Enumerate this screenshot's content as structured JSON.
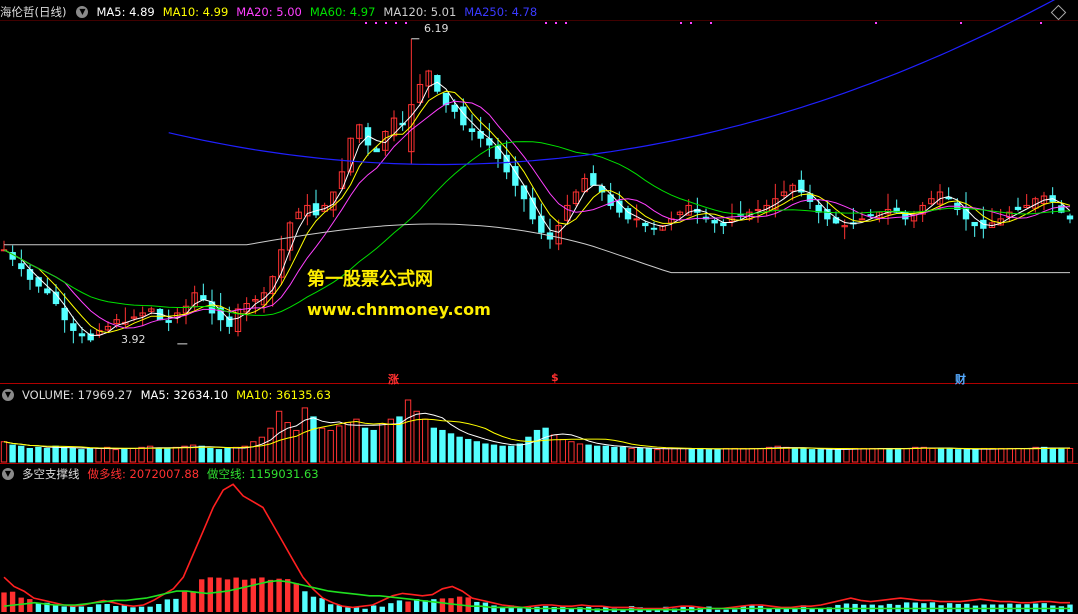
{
  "main_header": {
    "title": "海伦哲(日线)",
    "ma5": "MA5: 4.89",
    "ma10": "MA10: 4.99",
    "ma20": "MA20: 5.00",
    "ma60": "MA60: 4.97",
    "ma120": "MA120: 5.01",
    "ma250": "MA250: 4.78"
  },
  "price_labels": {
    "high": "6.19",
    "low": "3.92"
  },
  "event_tags": {
    "zhang": "涨",
    "dollar": "$",
    "cai": "财"
  },
  "watermark": {
    "line1": "第一股票公式网",
    "line2": "www.chnmoney.com"
  },
  "volume_header": {
    "volume": "VOLUME: 17969.27",
    "ma5": "MA5: 32634.10",
    "ma10": "MA10: 36135.63"
  },
  "indicator_header": {
    "title": "多空支撑线",
    "long_line": "做多线: 2072007.88",
    "short_line": "做空线: 1159031.63"
  },
  "colors": {
    "up": "#ff3232",
    "down": "#54ffff",
    "ma5": "#ffffff",
    "ma10": "#ffff00",
    "ma20": "#ff40ff",
    "ma60": "#00e000",
    "ma120": "#cccccc",
    "ma250": "#2020ff",
    "grid": "#b00000",
    "text": "#dddddd"
  },
  "chart_data": [
    {
      "type": "candlestick",
      "title": "海伦哲(日线)",
      "y_range": [
        3.8,
        6.3
      ],
      "annotated_high": 6.19,
      "annotated_low": 3.92,
      "close_path": [
        4.62,
        4.55,
        4.48,
        4.4,
        4.35,
        4.3,
        4.22,
        4.1,
        4.02,
        3.98,
        3.95,
        4.02,
        4.05,
        4.1,
        4.08,
        4.12,
        4.15,
        4.18,
        4.1,
        4.08,
        4.15,
        4.2,
        4.3,
        4.25,
        4.15,
        4.1,
        4.05,
        4.18,
        4.22,
        4.25,
        4.3,
        4.42,
        4.62,
        4.82,
        4.9,
        4.95,
        4.88,
        4.95,
        5.05,
        5.2,
        5.45,
        5.55,
        5.4,
        5.35,
        5.5,
        5.6,
        5.55,
        5.7,
        5.85,
        5.95,
        5.8,
        5.7,
        5.65,
        5.55,
        5.5,
        5.45,
        5.4,
        5.3,
        5.2,
        5.1,
        5.0,
        4.85,
        4.75,
        4.7,
        4.8,
        4.95,
        5.05,
        5.15,
        5.1,
        5.05,
        4.95,
        4.9,
        4.85,
        4.85,
        4.8,
        4.78,
        4.8,
        4.85,
        4.9,
        4.95,
        4.9,
        4.85,
        4.82,
        4.8,
        4.85,
        4.88,
        4.9,
        4.92,
        4.95,
        5.0,
        5.05,
        5.1,
        5.05,
        4.98,
        4.9,
        4.85,
        4.82,
        4.8,
        4.82,
        4.85,
        4.88,
        4.9,
        4.92,
        4.9,
        4.85,
        4.88,
        4.95,
        5.0,
        5.05,
        5.0,
        4.92,
        4.85,
        4.8,
        4.78,
        4.82,
        4.85,
        4.9,
        4.92,
        4.95,
        5.0,
        5.02,
        4.98,
        4.9,
        4.85
      ],
      "series_names": [
        "MA5",
        "MA10",
        "MA20",
        "MA60",
        "MA120",
        "MA250"
      ],
      "latest": {
        "MA5": 4.89,
        "MA10": 4.99,
        "MA20": 5.0,
        "MA60": 4.97,
        "MA120": 5.01,
        "MA250": 4.78
      }
    },
    {
      "type": "bar",
      "title": "VOLUME",
      "values": [
        18,
        15,
        14,
        12,
        13,
        12,
        14,
        13,
        12,
        11,
        12,
        12,
        13,
        11,
        12,
        12,
        13,
        14,
        12,
        12,
        13,
        14,
        15,
        14,
        12,
        11,
        12,
        13,
        14,
        18,
        22,
        30,
        45,
        35,
        28,
        48,
        40,
        30,
        28,
        32,
        35,
        38,
        30,
        28,
        34,
        38,
        40,
        55,
        45,
        38,
        30,
        28,
        25,
        22,
        20,
        18,
        16,
        15,
        14,
        14,
        16,
        22,
        28,
        30,
        24,
        20,
        18,
        16,
        15,
        14,
        14,
        13,
        13,
        12,
        12,
        12,
        11,
        12,
        12,
        12,
        12,
        12,
        11,
        11,
        12,
        12,
        12,
        12,
        12,
        13,
        14,
        13,
        12,
        12,
        11,
        11,
        11,
        11,
        12,
        12,
        12,
        12,
        12,
        12,
        12,
        12,
        13,
        13,
        12,
        12,
        12,
        11,
        11,
        11,
        12,
        12,
        12,
        12,
        12,
        12,
        13,
        13,
        12,
        12,
        12
      ],
      "series": [
        {
          "name": "MA5",
          "latest": 32634.1
        },
        {
          "name": "MA10",
          "latest": 36135.63
        }
      ],
      "latest": 17969.27
    },
    {
      "type": "line",
      "title": "多空支撑线",
      "series": [
        {
          "name": "做多线",
          "latest": 2072007.88,
          "shape": [
            0.3,
            0.22,
            0.18,
            0.12,
            0.1,
            0.08,
            0.06,
            0.05,
            0.06,
            0.08,
            0.1,
            0.08,
            0.06,
            0.05,
            0.06,
            0.1,
            0.15,
            0.2,
            0.3,
            0.5,
            0.7,
            0.9,
            1.05,
            1.1,
            1.0,
            0.95,
            0.9,
            0.75,
            0.6,
            0.45,
            0.3,
            0.2,
            0.12,
            0.08,
            0.05,
            0.04,
            0.05,
            0.06,
            0.1,
            0.14,
            0.16,
            0.15,
            0.14,
            0.15,
            0.2,
            0.22,
            0.18,
            0.12,
            0.1,
            0.08,
            0.06,
            0.05,
            0.04,
            0.05,
            0.06,
            0.06,
            0.05,
            0.05,
            0.06,
            0.05,
            0.05,
            0.04,
            0.04,
            0.04,
            0.03,
            0.03,
            0.03,
            0.04,
            0.05,
            0.05,
            0.04,
            0.03,
            0.03,
            0.04,
            0.05,
            0.06,
            0.06,
            0.05,
            0.04,
            0.04,
            0.05,
            0.05,
            0.06,
            0.08,
            0.1,
            0.12,
            0.1,
            0.09,
            0.1,
            0.11,
            0.12,
            0.11,
            0.1,
            0.1,
            0.09,
            0.09,
            0.09,
            0.1,
            0.11,
            0.1,
            0.09,
            0.09,
            0.08,
            0.08,
            0.09,
            0.09,
            0.08,
            0.08
          ]
        },
        {
          "name": "做空线",
          "latest": 1159031.63,
          "shape": [
            0.05,
            0.06,
            0.07,
            0.08,
            0.07,
            0.06,
            0.06,
            0.06,
            0.07,
            0.08,
            0.09,
            0.1,
            0.1,
            0.11,
            0.12,
            0.14,
            0.16,
            0.18,
            0.18,
            0.17,
            0.16,
            0.17,
            0.18,
            0.2,
            0.22,
            0.24,
            0.26,
            0.27,
            0.26,
            0.24,
            0.22,
            0.2,
            0.18,
            0.17,
            0.16,
            0.15,
            0.14,
            0.14,
            0.13,
            0.12,
            0.11,
            0.1,
            0.09,
            0.08,
            0.07,
            0.06,
            0.05,
            0.05,
            0.04,
            0.04,
            0.04,
            0.04,
            0.03,
            0.03,
            0.03,
            0.03,
            0.03,
            0.03,
            0.02,
            0.02,
            0.02,
            0.02,
            0.02,
            0.02,
            0.02,
            0.02,
            0.02,
            0.02,
            0.02,
            0.03,
            0.03,
            0.03,
            0.03,
            0.03,
            0.03,
            0.03,
            0.03,
            0.03,
            0.03,
            0.03,
            0.03,
            0.03,
            0.03,
            0.03,
            0.03,
            0.03,
            0.03,
            0.03,
            0.03,
            0.03,
            0.03,
            0.03,
            0.03,
            0.03,
            0.03,
            0.03,
            0.03,
            0.03,
            0.03,
            0.03,
            0.03,
            0.03,
            0.03,
            0.03,
            0.03,
            0.03
          ]
        }
      ]
    }
  ]
}
